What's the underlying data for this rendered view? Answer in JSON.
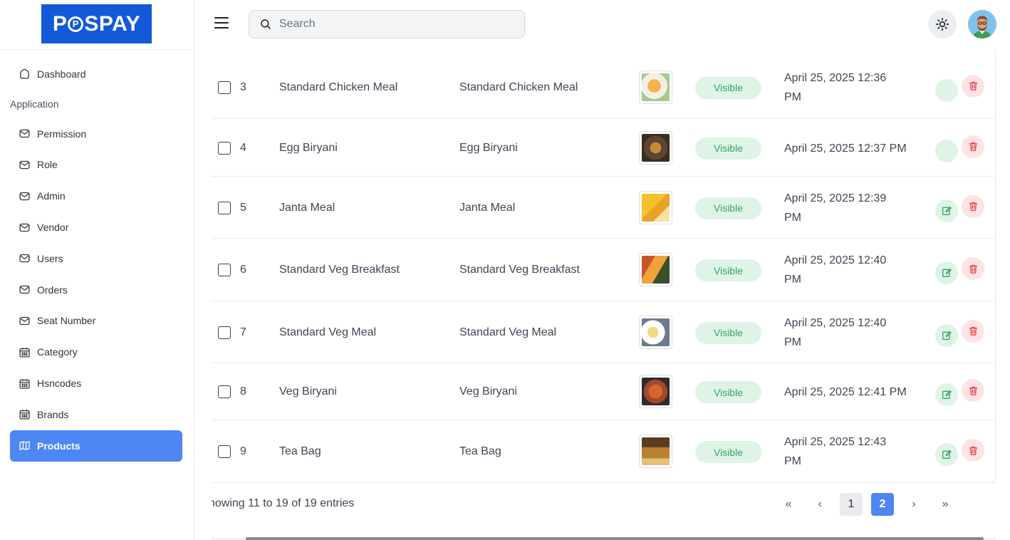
{
  "brand": {
    "logo_text_left": "P",
    "logo_coin": "P",
    "logo_text_right": "SPAY",
    "color": "#1459d9"
  },
  "sidebar": {
    "items": [
      {
        "label": "Dashboard",
        "icon": "home-icon",
        "active": false
      },
      {
        "section": "Application"
      },
      {
        "label": "Permission",
        "icon": "mail-icon",
        "active": false
      },
      {
        "label": "Role",
        "icon": "mail-icon",
        "active": false
      },
      {
        "label": "Admin",
        "icon": "mail-icon",
        "active": false
      },
      {
        "label": "Vendor",
        "icon": "mail-icon",
        "active": false
      },
      {
        "label": "Users",
        "icon": "mail-icon",
        "active": false
      },
      {
        "label": "Orders",
        "icon": "mail-icon",
        "active": false
      },
      {
        "label": "Seat Number",
        "icon": "mail-icon",
        "active": false
      },
      {
        "label": "Category",
        "icon": "calendar-icon",
        "active": false
      },
      {
        "label": "Hsncodes",
        "icon": "calendar-icon",
        "active": false
      },
      {
        "label": "Brands",
        "icon": "calendar-icon",
        "active": false
      },
      {
        "label": "Products",
        "icon": "map-icon",
        "active": true
      }
    ],
    "active_color": "#4e86f4"
  },
  "topbar": {
    "search_placeholder": "Search"
  },
  "table": {
    "rows": [
      {
        "num": "3",
        "name": "Standard Chicken Meal",
        "name2": "Standard Chicken Meal",
        "status": "Visible",
        "date_l1": "April 25, 2025 12:36",
        "date_l2": "PM",
        "has_edit_icon": false
      },
      {
        "num": "4",
        "name": "Egg Biryani",
        "name2": "Egg Biryani",
        "status": "Visible",
        "date_l1": "April 25, 2025 12:37 PM",
        "date_l2": "",
        "has_edit_icon": false
      },
      {
        "num": "5",
        "name": "Janta Meal",
        "name2": "Janta Meal",
        "status": "Visible",
        "date_l1": "April 25, 2025 12:39",
        "date_l2": "PM",
        "has_edit_icon": true
      },
      {
        "num": "6",
        "name": "Standard Veg Breakfast",
        "name2": "Standard Veg Breakfast",
        "status": "Visible",
        "date_l1": "April 25, 2025 12:40",
        "date_l2": "PM",
        "has_edit_icon": true
      },
      {
        "num": "7",
        "name": "Standard Veg Meal",
        "name2": "Standard Veg Meal",
        "status": "Visible",
        "date_l1": "April 25, 2025 12:40",
        "date_l2": "PM",
        "has_edit_icon": true
      },
      {
        "num": "8",
        "name": "Veg Biryani",
        "name2": "Veg Biryani",
        "status": "Visible",
        "date_l1": "April 25, 2025 12:41 PM",
        "date_l2": "",
        "has_edit_icon": true
      },
      {
        "num": "9",
        "name": "Tea Bag",
        "name2": "Tea Bag",
        "status": "Visible",
        "date_l1": "April 25, 2025 12:43",
        "date_l2": "PM",
        "has_edit_icon": true
      }
    ]
  },
  "footer": {
    "info": "howing 11 to 19 of 19 entries",
    "pager": {
      "first": "«",
      "prev": "‹",
      "pages": [
        "1",
        "2"
      ],
      "current": "2",
      "next": "›",
      "last": "»"
    }
  },
  "colors": {
    "badge_bg": "#dff3e6",
    "badge_text": "#33a866",
    "delete_bg": "#fde3e3",
    "delete_icon": "#e5484d",
    "edit_icon": "#33a866"
  }
}
